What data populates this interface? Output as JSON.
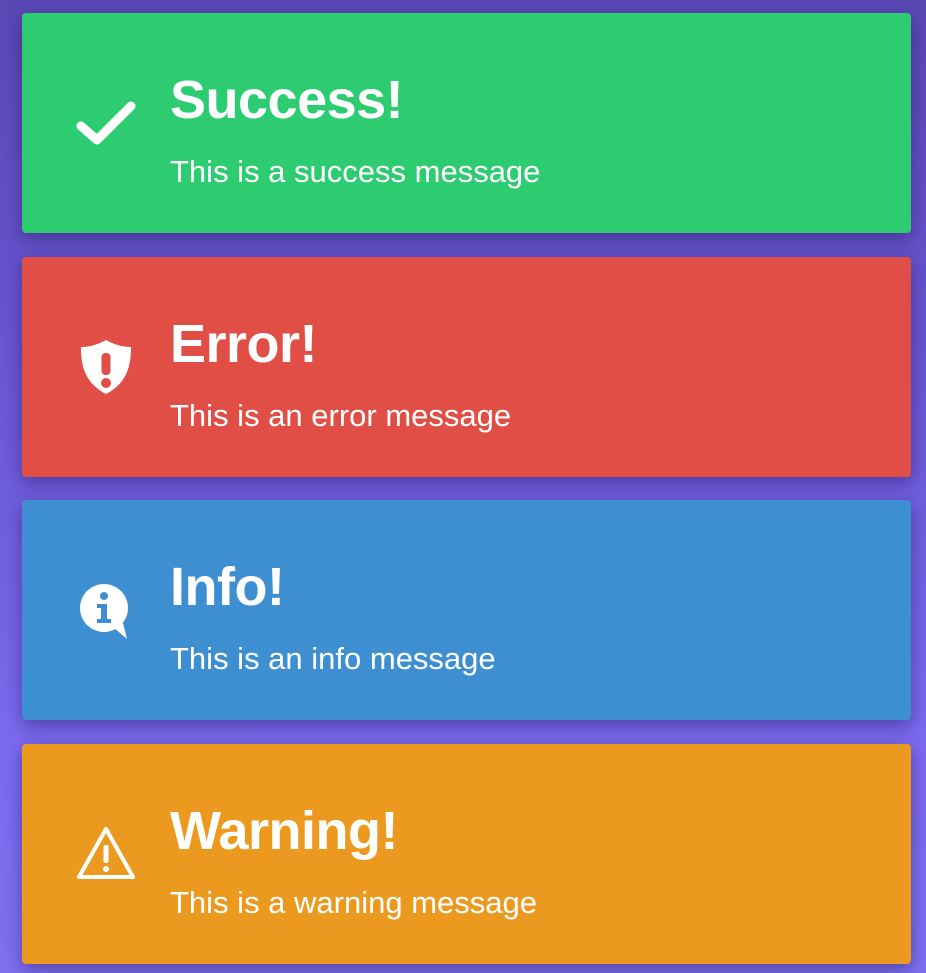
{
  "alerts": [
    {
      "type": "success",
      "title": "Success!",
      "message": "This is a success message",
      "icon": "check-icon",
      "color": "#2ecc71"
    },
    {
      "type": "error",
      "title": "Error!",
      "message": "This is an error message",
      "icon": "shield-exclamation-icon",
      "color": "#e04e46"
    },
    {
      "type": "info",
      "title": "Info!",
      "message": "This is an info message",
      "icon": "info-bubble-icon",
      "color": "#3d8fd1"
    },
    {
      "type": "warning",
      "title": "Warning!",
      "message": "This is a warning message",
      "icon": "warning-triangle-icon",
      "color": "#ec9a1f"
    }
  ]
}
